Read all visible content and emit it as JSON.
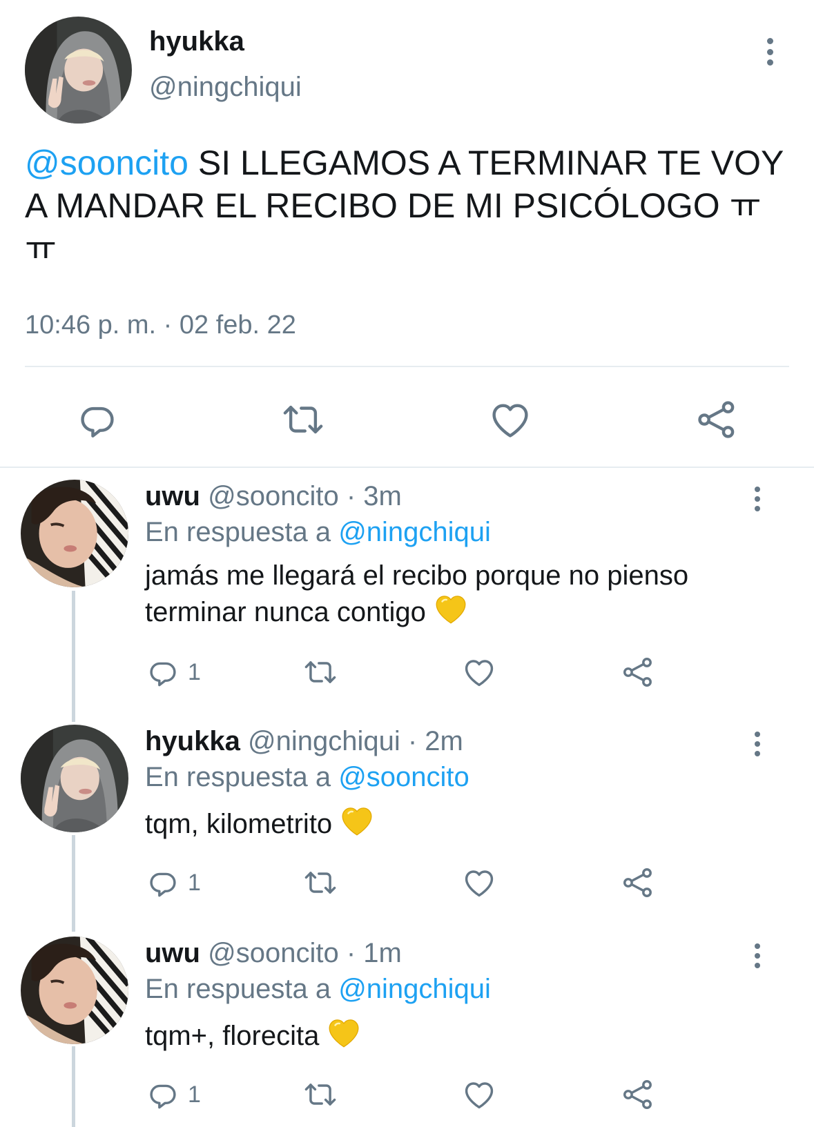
{
  "main_tweet": {
    "name": "hyukka",
    "handle": "@ningchiqui",
    "mention": "@sooncito",
    "text": " SI LLEGAMOS A TERMINAR TE VOY A MANDAR EL RECIBO DE MI PSICÓLOGO ㅠㅠ",
    "time": "10:46 p. m. · 02 feb. 22",
    "avatar_icon": "avatar-hooded-peace-sign",
    "actions": [
      "reply-icon",
      "retweet-icon",
      "like-icon",
      "share-icon"
    ]
  },
  "replies": [
    {
      "name": "uwu",
      "handle_time": "@sooncito · 3m",
      "reply_prefix": "En respuesta a ",
      "reply_to": "@ningchiqui",
      "text": "jamás me llegará el recibo porque no pienso terminar nunca contigo",
      "emoji": "yellow-heart",
      "reply_count": "1",
      "avatar_icon": "avatar-striped-shirt"
    },
    {
      "name": "hyukka",
      "handle_time": "@ningchiqui · 2m",
      "reply_prefix": "En respuesta a ",
      "reply_to": "@sooncito",
      "text": "tqm, kilometrito",
      "emoji": "yellow-heart",
      "reply_count": "1",
      "avatar_icon": "avatar-hooded-peace-sign"
    },
    {
      "name": "uwu",
      "handle_time": "@sooncito · 1m",
      "reply_prefix": "En respuesta a ",
      "reply_to": "@ningchiqui",
      "text": "tqm+, florecita",
      "emoji": "yellow-heart",
      "reply_count": "1",
      "avatar_icon": "avatar-striped-shirt"
    }
  ],
  "colors": {
    "accent": "#1da1f2",
    "muted": "#657786",
    "text": "#14171a",
    "divider": "#e6ecf0",
    "thread_line": "#ccd6dd",
    "heart_emoji": "#f5c518"
  }
}
